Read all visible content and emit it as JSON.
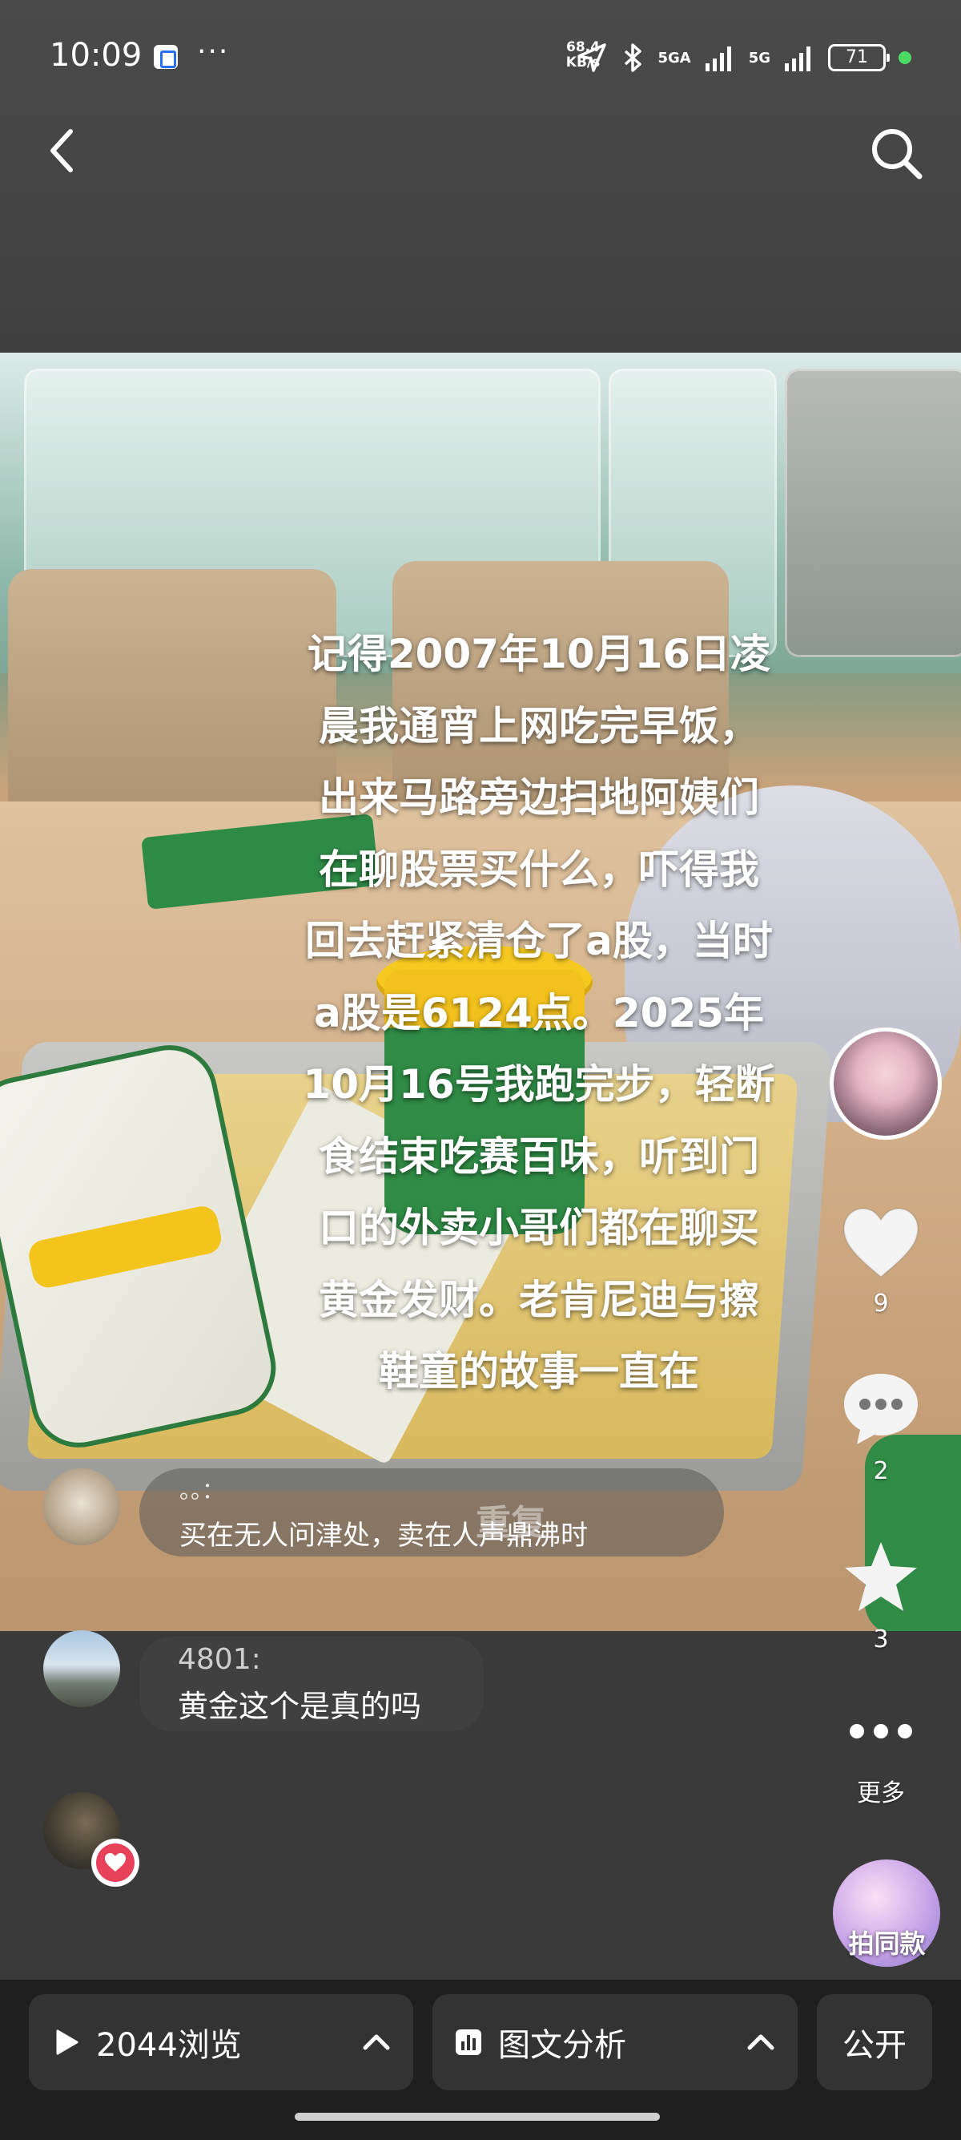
{
  "status_bar": {
    "time": "10:09",
    "more": "···",
    "net_speed_value": "68.4",
    "net_speed_unit": "KB/s",
    "network1": "5GA",
    "network2": "5G",
    "battery": "71"
  },
  "post": {
    "caption": "记得2007年10月16日凌晨我通宵上网吃完早饭，出来马路旁边扫地阿姨们在聊股票买什么，吓得我回去赶紧清仓了a股，当时a股是6124点。2025年10月16号我跑完步，轻断食结束吃赛百味，听到门口的外卖小哥们都在聊买黄金发财。老肯尼迪与擦鞋童的故事一直在"
  },
  "actions": {
    "like_count": "9",
    "comment_count": "2",
    "favorite_count": "3",
    "more_label": "更多",
    "remix_label": "拍同款"
  },
  "comments": [
    {
      "author": "。。：",
      "overlay": "重复",
      "text": "买在无人问津处，卖在人声鼎沸时"
    },
    {
      "author": "4801:",
      "text": "黄金这个是真的吗"
    }
  ],
  "bottom": {
    "views_label": "2044浏览",
    "analysis_label": "图文分析",
    "public_label": "公开"
  }
}
